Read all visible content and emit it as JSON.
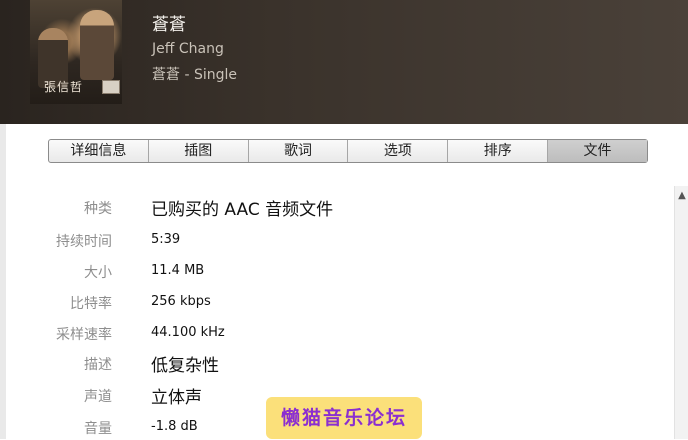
{
  "song": {
    "title": "蒼蒼",
    "artist": "Jeff Chang",
    "album": "蒼蒼 - Single"
  },
  "artwork": {
    "text": "張信哲"
  },
  "tabs": [
    {
      "label": "详细信息",
      "active": false
    },
    {
      "label": "插图",
      "active": false
    },
    {
      "label": "歌词",
      "active": false
    },
    {
      "label": "选项",
      "active": false
    },
    {
      "label": "排序",
      "active": false
    },
    {
      "label": "文件",
      "active": true
    }
  ],
  "file_info": [
    {
      "label": "种类",
      "value": "已购买的 AAC 音频文件"
    },
    {
      "label": "持续时间",
      "value": "5:39"
    },
    {
      "label": "大小",
      "value": "11.4 MB"
    },
    {
      "label": "比特率",
      "value": "256 kbps"
    },
    {
      "label": "采样速率",
      "value": "44.100 kHz"
    },
    {
      "label": "描述",
      "value": "低复杂性"
    },
    {
      "label": "声道",
      "value": "立体声"
    },
    {
      "label": "音量",
      "value": "-1.8 dB"
    }
  ],
  "scrollbar": {
    "up_icon": "chevron-up-icon"
  },
  "watermark": {
    "text": "懒猫音乐论坛"
  }
}
